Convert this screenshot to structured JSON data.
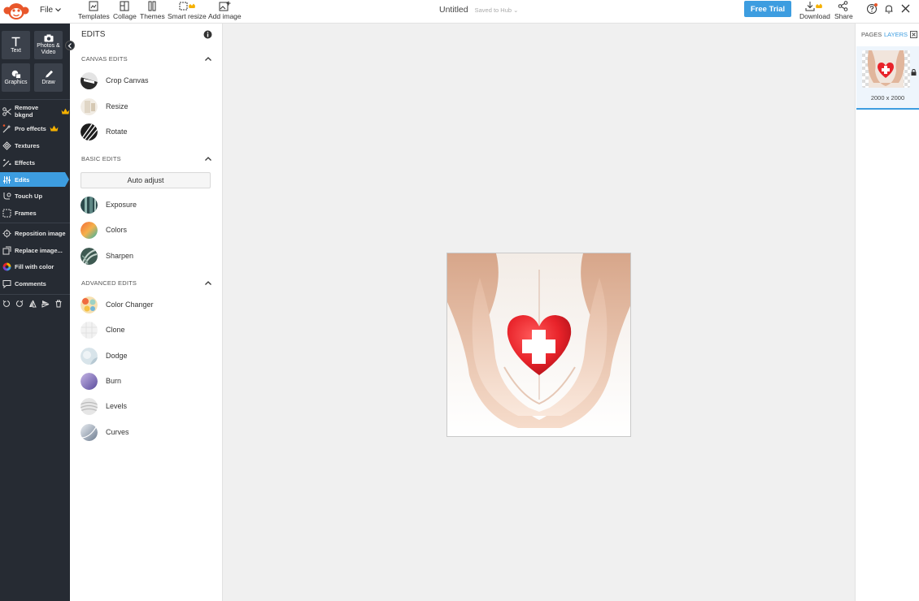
{
  "topbar": {
    "file_label": "File",
    "tools": [
      {
        "id": "templates",
        "label": "Templates",
        "icon": "templates-icon"
      },
      {
        "id": "collage",
        "label": "Collage",
        "icon": "collage-icon"
      },
      {
        "id": "themes",
        "label": "Themes",
        "icon": "themes-icon"
      },
      {
        "id": "smart-resize",
        "label": "Smart resize",
        "icon": "smart-resize-icon",
        "premium": true
      },
      {
        "id": "add-image",
        "label": "Add image",
        "icon": "add-image-icon"
      }
    ],
    "doc_title": "Untitled",
    "saved_status": "Saved to Hub",
    "free_trial_label": "Free Trial",
    "download_label": "Download",
    "share_label": "Share"
  },
  "left_rail": {
    "tiles": [
      {
        "label": "Text",
        "icon": "text-icon"
      },
      {
        "label": "Photos & Video",
        "icon": "camera-icon"
      },
      {
        "label": "Graphics",
        "icon": "graphics-icon"
      },
      {
        "label": "Draw",
        "icon": "pencil-icon"
      }
    ],
    "items": [
      {
        "label": "Remove bkgnd",
        "icon": "scissors-icon",
        "premium": true
      },
      {
        "label": "Pro effects",
        "icon": "magic-wand-icon",
        "premium": true
      },
      {
        "label": "Textures",
        "icon": "textures-icon"
      },
      {
        "label": "Effects",
        "icon": "effects-icon"
      },
      {
        "label": "Edits",
        "icon": "sliders-icon",
        "active": true
      },
      {
        "label": "Touch Up",
        "icon": "touch-up-icon"
      },
      {
        "label": "Frames",
        "icon": "frame-icon"
      },
      {
        "label": "Reposition image",
        "icon": "reposition-icon"
      },
      {
        "label": "Replace image...",
        "icon": "replace-image-icon"
      },
      {
        "label": "Fill with color",
        "icon": "color-wheel-icon"
      },
      {
        "label": "Comments",
        "icon": "comment-icon"
      }
    ]
  },
  "edits_panel": {
    "title": "EDITS",
    "canvas_edits": {
      "heading": "CANVAS EDITS",
      "items": [
        {
          "label": "Crop Canvas",
          "icon": "crop-canvas-icon"
        },
        {
          "label": "Resize",
          "icon": "resize-icon"
        },
        {
          "label": "Rotate",
          "icon": "rotate-icon"
        }
      ]
    },
    "basic_edits": {
      "heading": "BASIC EDITS",
      "auto_adjust_label": "Auto adjust",
      "items": [
        {
          "label": "Exposure",
          "icon": "exposure-icon"
        },
        {
          "label": "Colors",
          "icon": "colors-icon"
        },
        {
          "label": "Sharpen",
          "icon": "sharpen-icon"
        }
      ]
    },
    "advanced_edits": {
      "heading": "ADVANCED EDITS",
      "items": [
        {
          "label": "Color Changer",
          "icon": "color-changer-icon"
        },
        {
          "label": "Clone",
          "icon": "clone-icon"
        },
        {
          "label": "Dodge",
          "icon": "dodge-icon"
        },
        {
          "label": "Burn",
          "icon": "burn-icon"
        },
        {
          "label": "Levels",
          "icon": "levels-icon"
        },
        {
          "label": "Curves",
          "icon": "curves-icon"
        }
      ]
    }
  },
  "right_panel": {
    "tabs": [
      {
        "label": "PAGES",
        "active": false
      },
      {
        "label": "LAYERS",
        "active": true
      }
    ],
    "layer_size": "2000 x 2000"
  },
  "colors": {
    "accent": "#3d9de0",
    "rail_bg": "#262b33",
    "heart_red": "#e8232a",
    "premium_gold": "#f5b100"
  }
}
